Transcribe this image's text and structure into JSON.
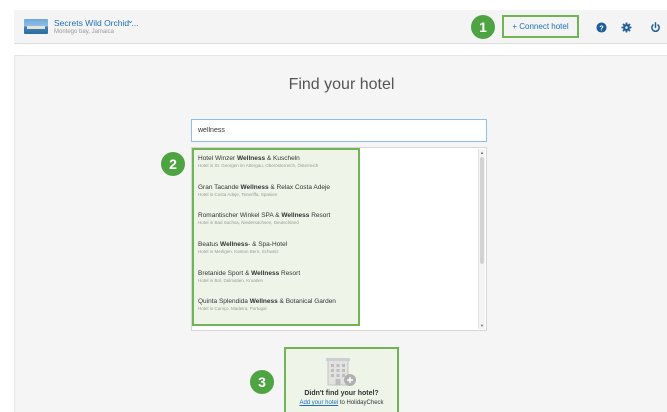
{
  "header": {
    "hotel_name": "Secrets Wild Orchid ...",
    "hotel_location": "Montego bay, Jamaica",
    "connect_label": "+ Connect hotel"
  },
  "badges": {
    "one": "1",
    "two": "2",
    "three": "3"
  },
  "main": {
    "title": "Find your hotel",
    "search_value": "wellness"
  },
  "results": [
    {
      "pre": "Hotel Winzer ",
      "match": "Wellness",
      "post": " & Kuscheln",
      "sub": "Hotel in St. Georgen im Attergau, Oberösterreich, Österreich"
    },
    {
      "pre": "Gran Tacande ",
      "match": "Wellness",
      "post": " & Relax Costa Adeje",
      "sub": "Hotel in Costa Adeje, Teneriffa, Spanien"
    },
    {
      "pre": "Romantischer Winkel SPA & ",
      "match": "Wellness",
      "post": " Resort",
      "sub": "Hotel in Bad Sachsa, Niedersachsen, Deutschland"
    },
    {
      "pre": "Beatus ",
      "match": "Wellness",
      "post": "- & Spa-Hotel",
      "sub": "Hotel in Merligen, Kanton Bern, Schweiz"
    },
    {
      "pre": "Bretanide Sport & ",
      "match": "Wellness",
      "post": " Resort",
      "sub": "Hotel in Bol, Dalmatien, Kroatien"
    },
    {
      "pre": "Quinta Splendida ",
      "match": "Wellness",
      "post": " & Botanical Garden",
      "sub": "Hotel in Caniço, Madeira, Portugal"
    }
  ],
  "add_hotel": {
    "title": "Didn't find your hotel?",
    "link_text": "Add your hotel",
    "link_suffix": " to HolidayCheck"
  },
  "colors": {
    "accent_green": "#4ea443",
    "link_blue": "#1d6fb8",
    "highlight_border": "#6fb555"
  },
  "icons": [
    "chevron-down-icon",
    "help-icon",
    "gear-icon",
    "power-icon",
    "building-icon",
    "plus-icon"
  ]
}
